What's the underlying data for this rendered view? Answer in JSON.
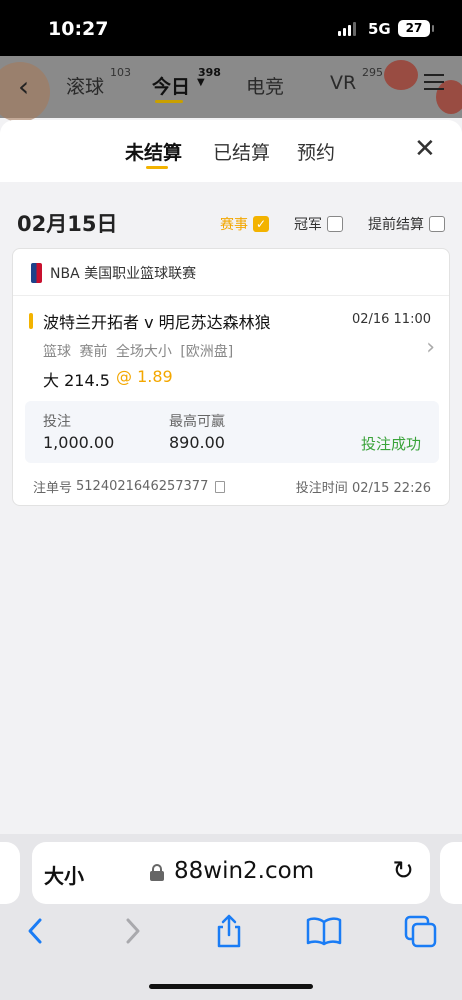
{
  "status_bar": {
    "time": "10:27",
    "network": "5G",
    "battery": "27"
  },
  "top_nav": {
    "items": [
      {
        "label": "滚球",
        "count": "103"
      },
      {
        "label": "今日",
        "count": "398"
      },
      {
        "label": "电竞"
      },
      {
        "label": "VR",
        "count": "295"
      }
    ]
  },
  "sheet": {
    "tabs": [
      "未结算",
      "已结算",
      "预约"
    ],
    "active_tab": "未结算"
  },
  "filters": {
    "date": "02月15日",
    "items": [
      {
        "label": "赛事",
        "checked": true
      },
      {
        "label": "冠军",
        "checked": false
      },
      {
        "label": "提前结算",
        "checked": false
      }
    ]
  },
  "bet": {
    "league": "NBA 美国职业篮球联赛",
    "match": "波特兰开拓者 v 明尼苏达森林狼",
    "match_time": "02/16 11:00",
    "market": "篮球  赛前  全场大小 [欧洲盘]",
    "pick": "大 214.5",
    "odds": "@ 1.89",
    "stake_label": "投注",
    "stake_value": "1,000.00",
    "max_win_label": "最高可赢",
    "max_win_value": "890.00",
    "status": "投注成功",
    "order_label": "注单号",
    "order_number": "5124021646257377",
    "bet_time_label": "投注时间",
    "bet_time": "02/15 22:26"
  },
  "browser": {
    "text_size": "大小",
    "url": "88win2.com"
  },
  "colors": {
    "accent": "#f3b300",
    "success": "#3aa33a"
  }
}
